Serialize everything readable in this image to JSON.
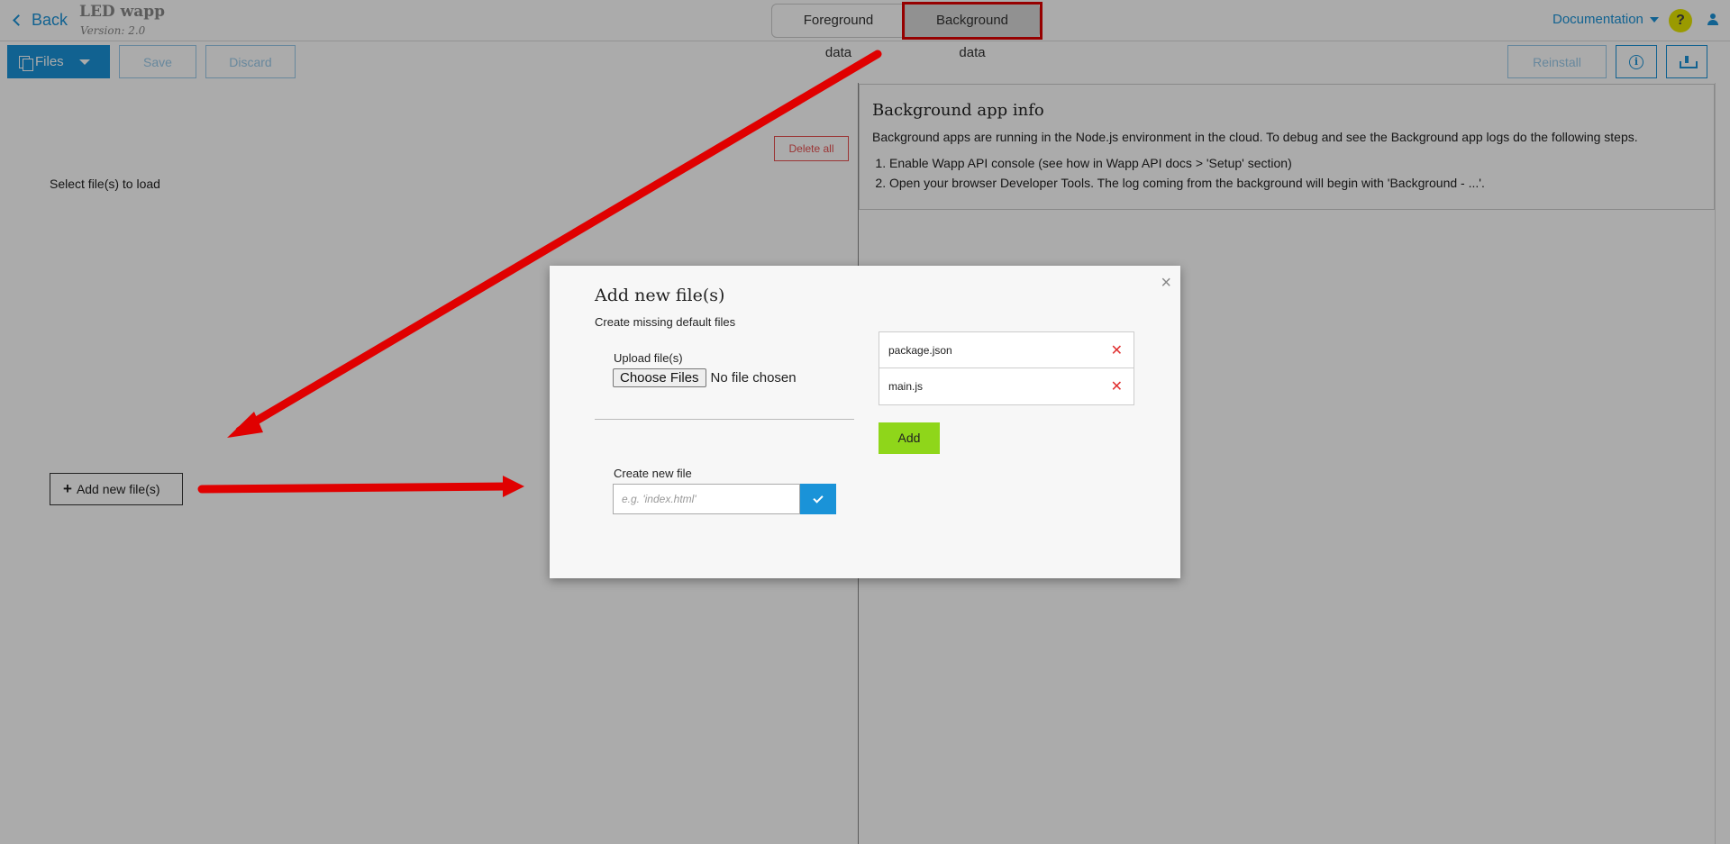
{
  "header": {
    "back_label": "Back",
    "app_title": "LED wapp",
    "app_version": "Version: 2.0",
    "tabs": [
      {
        "label": "Foreground data"
      },
      {
        "label": "Background data"
      }
    ],
    "docs_label": "Documentation",
    "help_glyph": "?"
  },
  "toolbar": {
    "files_label": "Files",
    "save_label": "Save",
    "discard_label": "Discard",
    "reinstall_label": "Reinstall"
  },
  "left": {
    "delete_all_label": "Delete all",
    "select_text": "Select file(s) to load",
    "add_files_label": "Add new file(s)"
  },
  "info": {
    "title": "Background app info",
    "description": "Background apps are running in the Node.js environment in the cloud. To debug and see the Background app logs do the following steps.",
    "steps": [
      "Enable Wapp API console (see how in Wapp API docs > 'Setup' section)",
      "Open your browser Developer Tools. The log coming from the background will begin with 'Background - ...'."
    ]
  },
  "modal": {
    "title": "Add new file(s)",
    "subtitle": "Create missing default files",
    "upload_label": "Upload file(s)",
    "choose_label": "Choose Files",
    "no_file_text": "No file chosen",
    "create_label": "Create new file",
    "create_placeholder": "e.g. 'index.html'",
    "files": [
      {
        "name": "package.json"
      },
      {
        "name": "main.js"
      }
    ],
    "add_label": "Add",
    "close_glyph": "×"
  },
  "colors": {
    "accent": "#1a93d8",
    "add_green": "#8fd61a",
    "danger": "#e85050",
    "annotation": "#e00000"
  }
}
